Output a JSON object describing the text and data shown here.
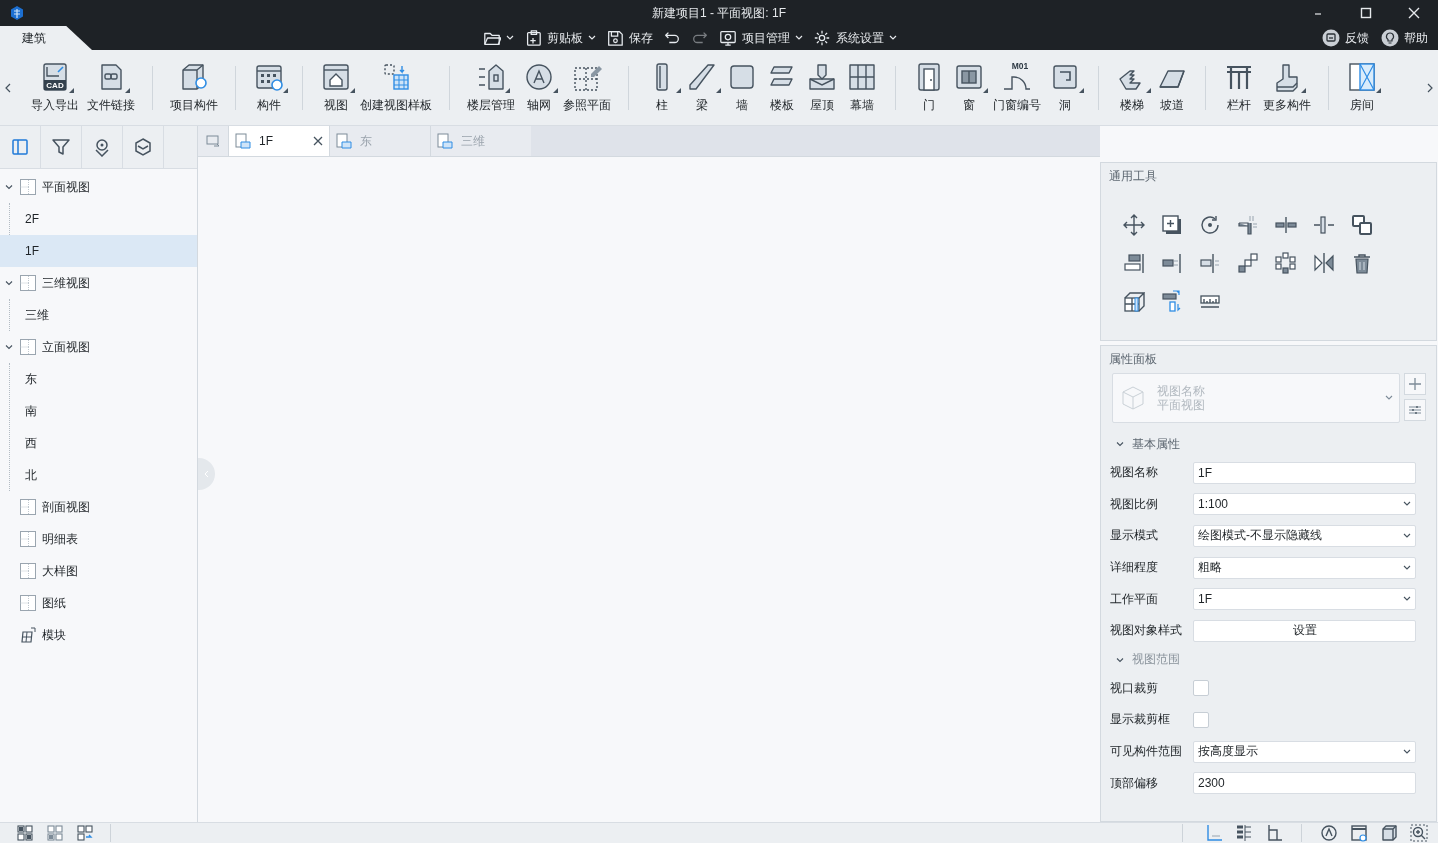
{
  "window": {
    "title": "新建项目1 - 平面视图: 1F"
  },
  "ribbon_tabs": [
    {
      "label": "建筑",
      "selected": true
    }
  ],
  "quick_menu": [
    {
      "kind": "icon-menu",
      "disabled": false
    },
    {
      "kind": "menu",
      "label": "剪贴板",
      "disabled": false
    },
    {
      "kind": "button",
      "label": "保存",
      "disabled": false
    },
    {
      "kind": "icon",
      "disabled": false
    },
    {
      "kind": "icon",
      "disabled": true
    },
    {
      "kind": "menu",
      "label": "项目管理",
      "disabled": false
    },
    {
      "kind": "menu",
      "label": "系统设置",
      "disabled": false
    }
  ],
  "help_links": [
    {
      "label": "反馈"
    },
    {
      "label": "帮助"
    }
  ],
  "ribbon_groups": [
    [
      {
        "label": "导入导出",
        "dropdown": true,
        "icon_text": "CAD"
      },
      {
        "label": "文件链接",
        "dropdown": true
      }
    ],
    [
      {
        "label": "项目构件",
        "dropdown": false
      }
    ],
    [
      {
        "label": "构件",
        "dropdown": true
      }
    ],
    [
      {
        "label": "视图",
        "dropdown": true
      },
      {
        "label": "创建视图样板",
        "dropdown": false
      }
    ],
    [
      {
        "label": "楼层管理",
        "dropdown": true
      },
      {
        "label": "轴网",
        "dropdown": true
      },
      {
        "label": "参照平面",
        "dropdown": false
      }
    ],
    [
      {
        "label": "柱",
        "dropdown": true
      },
      {
        "label": "梁",
        "dropdown": true
      },
      {
        "label": "墙",
        "dropdown": false
      },
      {
        "label": "楼板",
        "dropdown": false
      },
      {
        "label": "屋顶",
        "dropdown": false
      },
      {
        "label": "幕墙",
        "dropdown": false
      }
    ],
    [
      {
        "label": "门",
        "dropdown": false
      },
      {
        "label": "窗",
        "dropdown": true
      },
      {
        "label": "门窗编号",
        "dropdown": false,
        "icon_text": "M01"
      },
      {
        "label": "洞",
        "dropdown": true
      }
    ],
    [
      {
        "label": "楼梯",
        "dropdown": true
      },
      {
        "label": "坡道",
        "dropdown": false
      }
    ],
    [
      {
        "label": "栏杆",
        "dropdown": false
      },
      {
        "label": "更多构件",
        "dropdown": true
      }
    ],
    [
      {
        "label": "房间",
        "dropdown": true
      }
    ]
  ],
  "panel_tabs": [
    {
      "selected": true
    },
    {
      "selected": false
    },
    {
      "selected": false
    },
    {
      "selected": false
    }
  ],
  "tree": [
    {
      "label": "平面视图",
      "kind": "folder",
      "expanded": true,
      "selected": false,
      "children": [
        {
          "label": "2F",
          "selected": false
        },
        {
          "label": "1F",
          "selected": true
        }
      ]
    },
    {
      "label": "三维视图",
      "kind": "folder",
      "expanded": true,
      "selected": false,
      "children": [
        {
          "label": "三维",
          "selected": false
        }
      ]
    },
    {
      "label": "立面视图",
      "kind": "folder",
      "expanded": true,
      "selected": false,
      "children": [
        {
          "label": "东",
          "selected": false
        },
        {
          "label": "南",
          "selected": false
        },
        {
          "label": "西",
          "selected": false
        },
        {
          "label": "北",
          "selected": false
        }
      ]
    },
    {
      "label": "剖面视图",
      "kind": "folder",
      "selected": false
    },
    {
      "label": "明细表",
      "kind": "folder",
      "selected": false
    },
    {
      "label": "大样图",
      "kind": "folder",
      "selected": false
    },
    {
      "label": "图纸",
      "kind": "folder",
      "selected": false
    },
    {
      "label": "模块",
      "kind": "module",
      "selected": false
    }
  ],
  "doc_tabs": [
    {
      "label": "1F",
      "selected": true
    },
    {
      "label": "东",
      "selected": false
    },
    {
      "label": "三维",
      "selected": false
    }
  ],
  "general_tools": {
    "title": "通用工具"
  },
  "properties": {
    "title": "属性面板",
    "type_selector": {
      "label": "视图名称",
      "value": "平面视图"
    },
    "sections": [
      {
        "title": "基本属性",
        "expanded": true,
        "rows": [
          {
            "label": "视图名称",
            "kind": "text",
            "value": "1F"
          },
          {
            "label": "视图比例",
            "kind": "select",
            "value": "1:100"
          },
          {
            "label": "显示模式",
            "kind": "select",
            "value": "绘图模式-不显示隐藏线"
          },
          {
            "label": "详细程度",
            "kind": "select",
            "value": "粗略"
          },
          {
            "label": "工作平面",
            "kind": "select",
            "value": "1F"
          },
          {
            "label": "视图对象样式",
            "kind": "button",
            "value": "设置"
          }
        ]
      },
      {
        "title": "视图范围",
        "expanded": true,
        "rows": [
          {
            "label": "视口裁剪",
            "kind": "checkbox",
            "checked": false
          },
          {
            "label": "显示裁剪框",
            "kind": "checkbox",
            "checked": false
          },
          {
            "label": "可见构件范围",
            "kind": "select",
            "value": "按高度显示"
          },
          {
            "label": "顶部偏移",
            "kind": "text",
            "value": "2300"
          }
        ]
      }
    ]
  }
}
